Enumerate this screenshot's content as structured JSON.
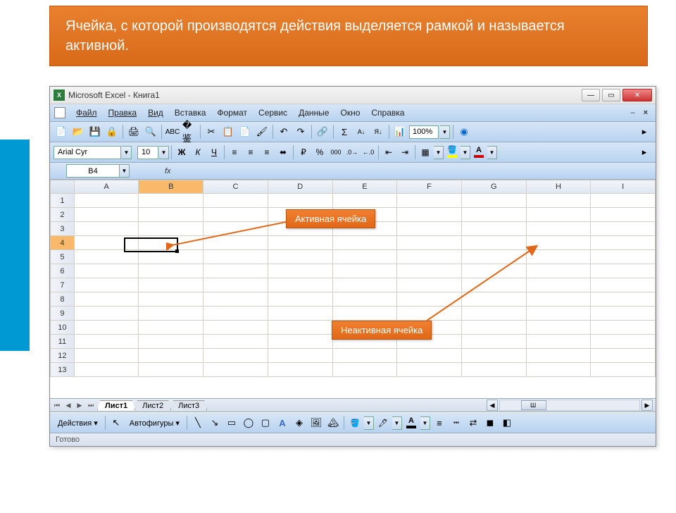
{
  "slide": {
    "header": "Ячейка, с которой производятся действия выделяется рамкой и называется активной."
  },
  "window": {
    "title": "Microsoft Excel - Книга1"
  },
  "menu": {
    "file": "Файл",
    "edit": "Правка",
    "view": "Вид",
    "insert": "Вставка",
    "format": "Формат",
    "tools": "Сервис",
    "data": "Данные",
    "window_m": "Окно",
    "help": "Справка"
  },
  "toolbar": {
    "zoom": "100%"
  },
  "format": {
    "font": "Arial Cyr",
    "size": "10"
  },
  "namebox": {
    "cell": "B4",
    "fx": "fx"
  },
  "columns": [
    "A",
    "B",
    "C",
    "D",
    "E",
    "F",
    "G",
    "H",
    "I"
  ],
  "rows": [
    "1",
    "2",
    "3",
    "4",
    "5",
    "6",
    "7",
    "8",
    "9",
    "10",
    "11",
    "12",
    "13"
  ],
  "active_col": "B",
  "active_row": "4",
  "callouts": {
    "active": "Активная ячейка",
    "inactive": "Неактивная ячейка"
  },
  "tabs": {
    "sheet1": "Лист1",
    "sheet2": "Лист2",
    "sheet3": "Лист3",
    "scroll_marker": "Ш"
  },
  "draw": {
    "actions": "Действия",
    "autoshapes": "Автофигуры"
  },
  "status": {
    "ready": "Готово"
  }
}
